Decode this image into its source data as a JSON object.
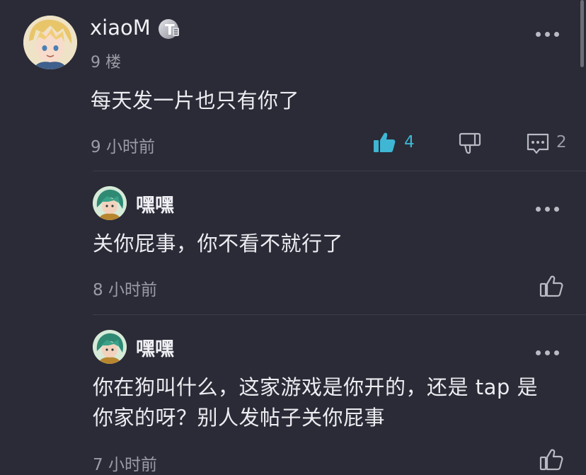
{
  "main_comment": {
    "username": "xiaoM",
    "badge": "T",
    "floor": "9 楼",
    "text": "每天发一片也只有你了",
    "time": "9 小时前",
    "like_count": "4",
    "reply_count": "2"
  },
  "replies": [
    {
      "username": "嘿嘿",
      "text": "关你屁事，你不看不就行了",
      "time": "8 小时前"
    },
    {
      "username": "嘿嘿",
      "text_line1": "你在狗叫什么，这家游戏是你开的，还是 tap 是",
      "text_line2": "你家的呀？别人发帖子关你屁事",
      "time": "7 小时前"
    }
  ],
  "icons": {
    "like": "thumb-up-icon",
    "dislike": "thumb-down-icon",
    "comment": "comment-icon",
    "more": "more-dots-icon"
  },
  "colors": {
    "background": "#2a2b36",
    "accent": "#3fb6d4",
    "muted_text": "#9a9ba6"
  }
}
